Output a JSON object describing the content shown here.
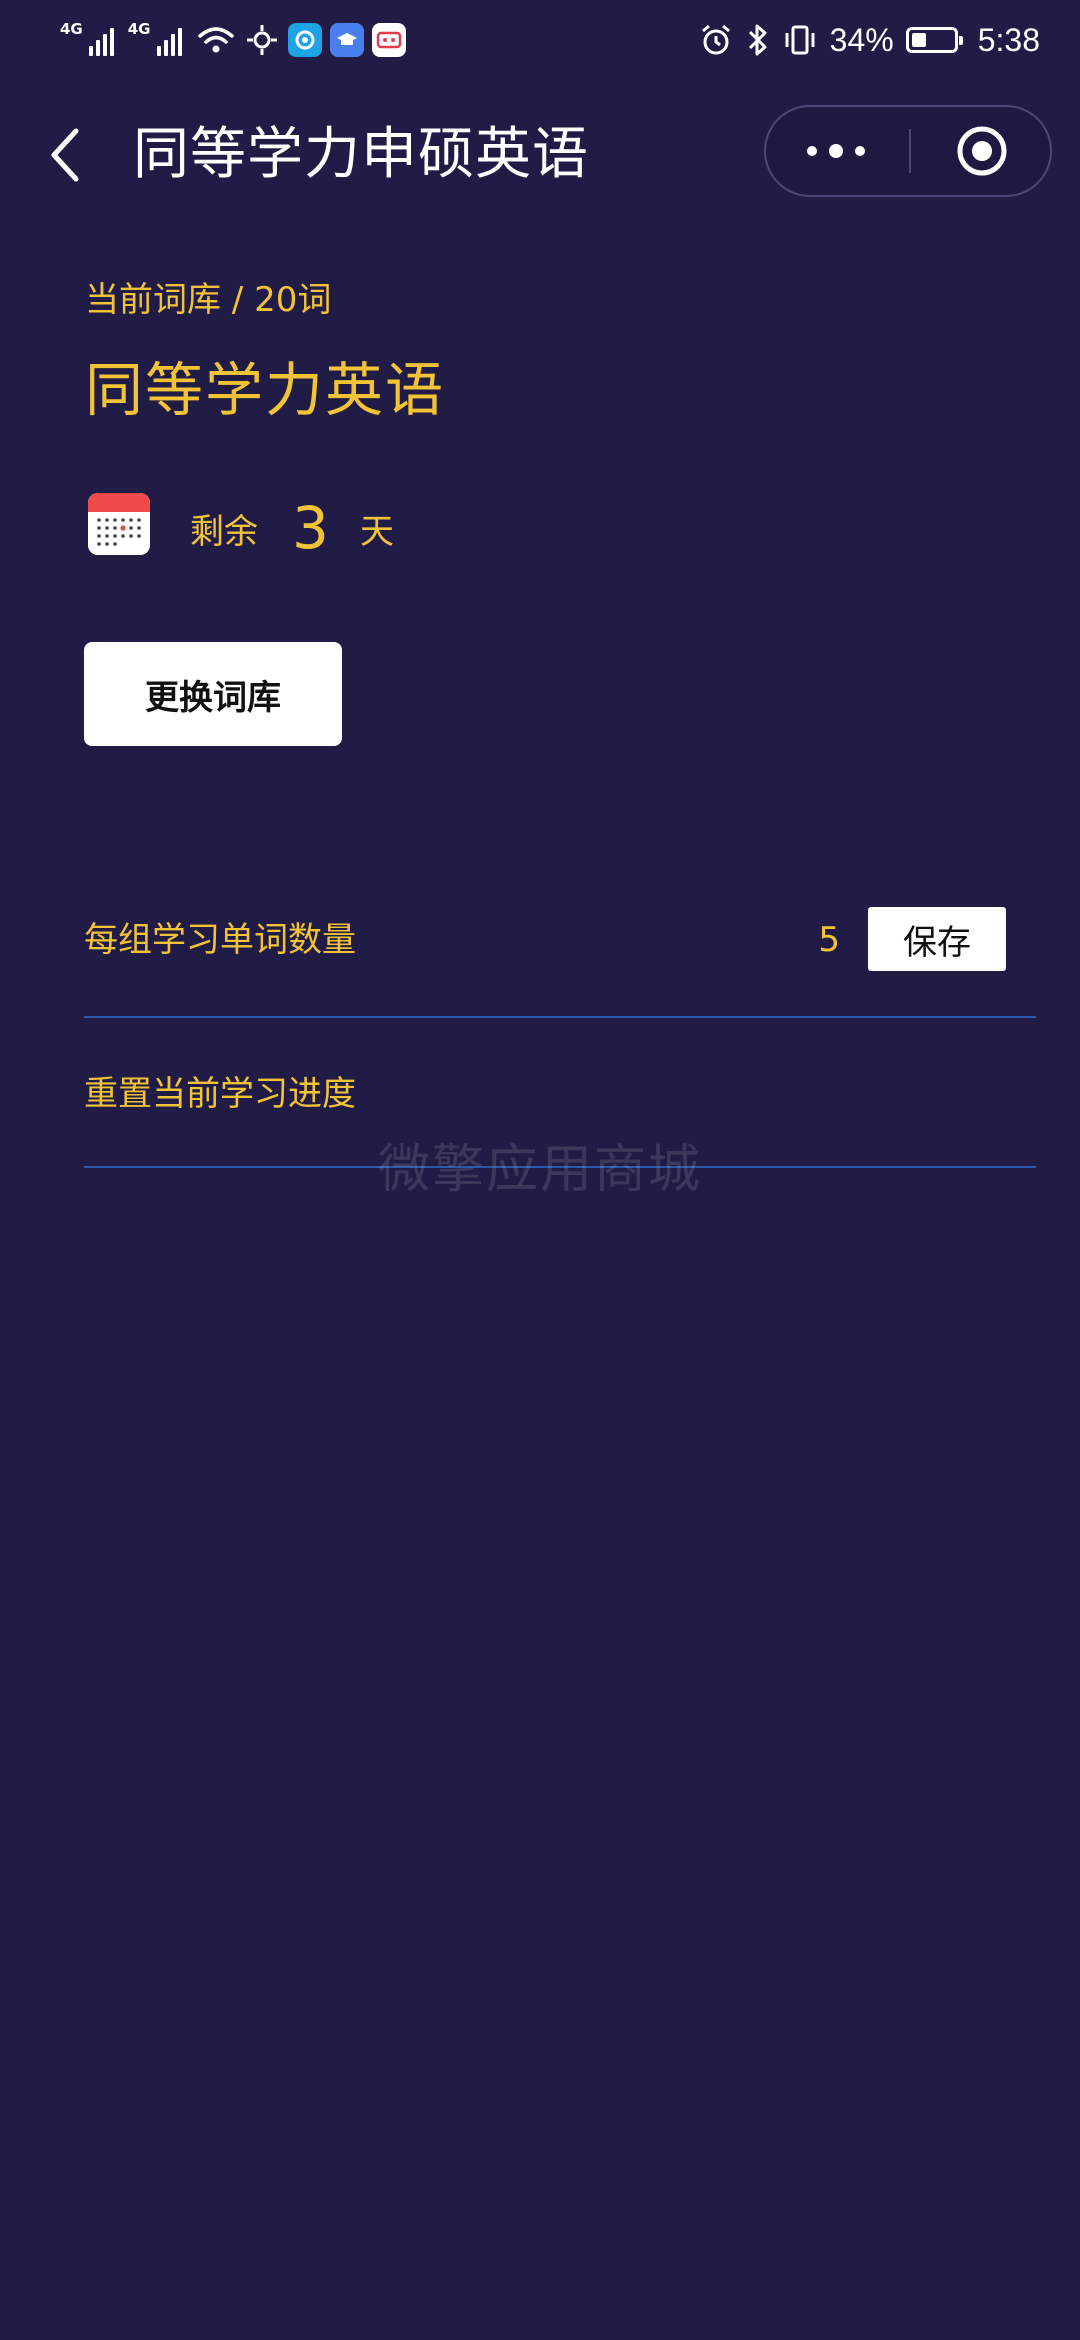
{
  "status_bar": {
    "network_1": "4G",
    "network_2": "4G",
    "battery_percent": "34%",
    "battery_level": 0.34,
    "time": "5:38",
    "icons": [
      "signal-icon",
      "wifi-icon",
      "hotspot-icon",
      "app-icon-c",
      "app-icon-edu",
      "app-icon-game",
      "alarm-icon",
      "bluetooth-icon",
      "vibrate-icon",
      "battery-icon"
    ]
  },
  "nav": {
    "title": "同等学力申硕英语",
    "back_icon": "chevron-left-icon",
    "more_icon": "more-dots-icon",
    "close_icon": "target-circle-icon"
  },
  "library": {
    "info": "当前词库 / 20词",
    "name": "同等学力英语",
    "calendar_icon": "calendar-icon",
    "remain_label": "剩余",
    "remain_days": "3",
    "remain_unit": "天",
    "change_button": "更换词库"
  },
  "settings": {
    "words_per_group_label": "每组学习单词数量",
    "words_per_group_value": "5",
    "save_button": "保存",
    "reset_label": "重置当前学习进度"
  },
  "watermark": "微擎应用商城",
  "colors": {
    "background": "#211c45",
    "accent": "#f3c336",
    "divider": "#2a57a8",
    "button_bg": "#ffffff"
  }
}
